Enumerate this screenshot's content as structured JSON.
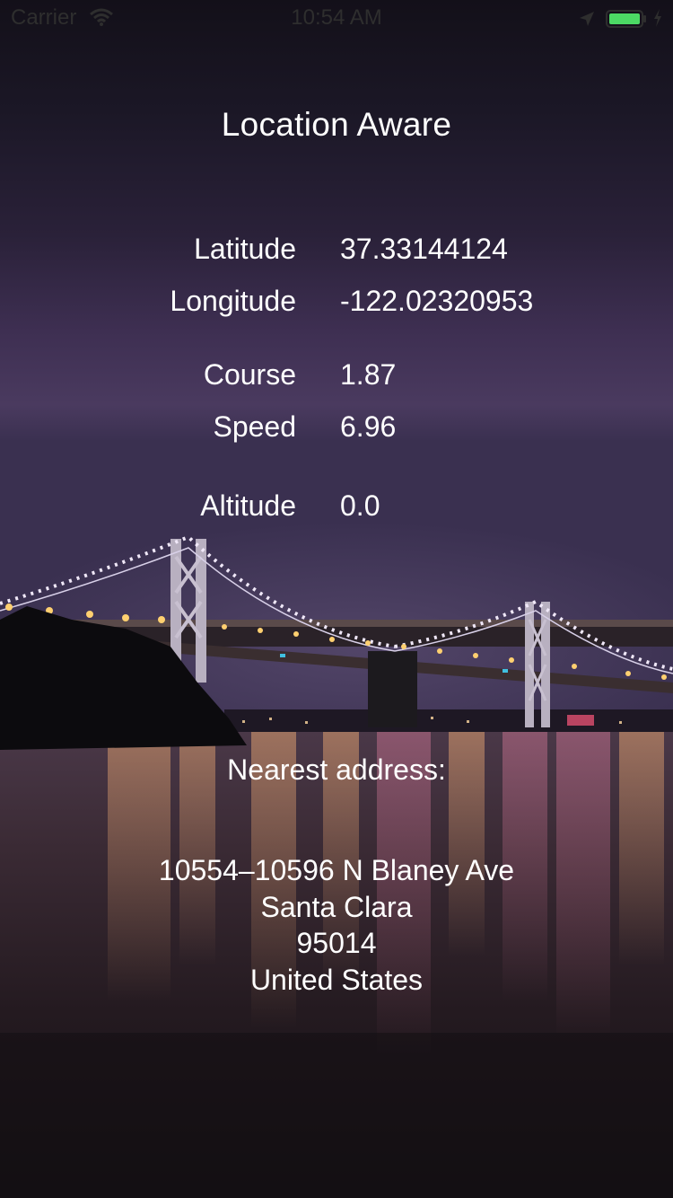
{
  "status_bar": {
    "carrier": "Carrier",
    "time": "10:54 AM",
    "wifi_icon": "wifi-icon",
    "location_icon": "location-arrow-icon",
    "battery_icon": "battery-icon",
    "charging_icon": "charging-bolt-icon",
    "battery_color": "#4cd964"
  },
  "title": "Location Aware",
  "readout": {
    "latitude": {
      "label": "Latitude",
      "value": "37.33144124"
    },
    "longitude": {
      "label": "Longitude",
      "value": "-122.02320953"
    },
    "course": {
      "label": "Course",
      "value": "1.87"
    },
    "speed": {
      "label": "Speed",
      "value": "6.96"
    },
    "altitude": {
      "label": "Altitude",
      "value": "0.0"
    }
  },
  "address": {
    "heading": "Nearest address:",
    "street": "10554–10596 N Blaney Ave",
    "city": "Santa Clara",
    "postal_code": "95014",
    "country": "United States"
  }
}
